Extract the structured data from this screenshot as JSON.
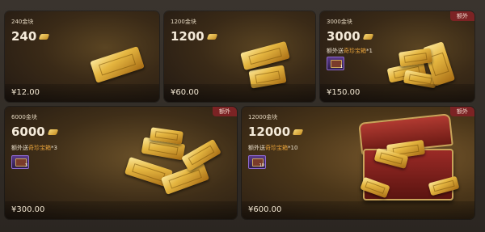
{
  "packages": [
    {
      "title": "240金块",
      "amount": "240",
      "price": "¥12.00"
    },
    {
      "title": "1200金块",
      "amount": "1200",
      "price": "¥60.00"
    },
    {
      "title": "3000金块",
      "amount": "3000",
      "price": "¥150.00",
      "badge": "额外",
      "bonus_prefix": "额外送",
      "bonus_item": "奇珍宝箱",
      "bonus_qty": "*1",
      "chest_count": "1"
    },
    {
      "title": "6000金块",
      "amount": "6000",
      "price": "¥300.00",
      "badge": "额外",
      "bonus_prefix": "额外送",
      "bonus_item": "奇珍宝箱",
      "bonus_qty": "*3",
      "chest_count": "3"
    },
    {
      "title": "12000金块",
      "amount": "12000",
      "price": "¥600.00",
      "badge": "额外",
      "bonus_prefix": "额外送",
      "bonus_item": "奇珍宝箱",
      "bonus_qty": "*10",
      "chest_count": "10"
    }
  ],
  "colors": {
    "accent": "#e8a33b",
    "badge_bg": "#7c2324",
    "gold": "#e5b640"
  },
  "icons": {
    "currency": "gold-ingot-icon",
    "bonus": "treasure-chest-icon"
  }
}
